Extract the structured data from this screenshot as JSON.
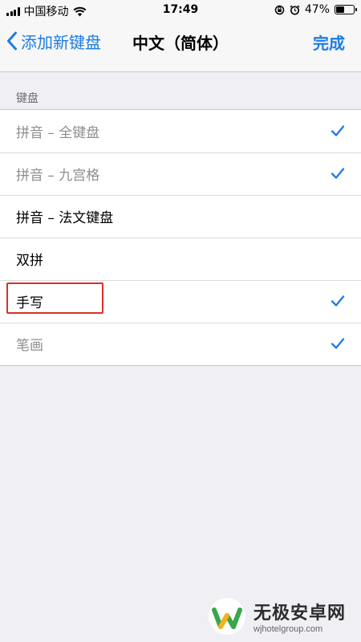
{
  "status_bar": {
    "carrier": "中国移动",
    "time": "17:49",
    "battery_percent": "47%",
    "battery_level": 0.47,
    "icons": [
      "signal-icon",
      "wifi-icon",
      "rotation-lock-icon",
      "alarm-icon",
      "battery-icon"
    ]
  },
  "nav": {
    "back_label": "添加新键盘",
    "title": "中文（简体）",
    "done_label": "完成"
  },
  "section": {
    "header": "键盘"
  },
  "rows": [
    {
      "label": "拼音 – 全键盘",
      "checked": true,
      "dimmed": true
    },
    {
      "label": "拼音 – 九宫格",
      "checked": true,
      "dimmed": true
    },
    {
      "label": "拼音 – 法文键盘",
      "checked": false,
      "dimmed": false
    },
    {
      "label": "双拼",
      "checked": false,
      "dimmed": false
    },
    {
      "label": "手写",
      "checked": true,
      "dimmed": false
    },
    {
      "label": "笔画",
      "checked": true,
      "dimmed": true
    }
  ],
  "colors": {
    "accent": "#1c7ce5",
    "highlight": "#d9302c",
    "background": "#efeff4"
  },
  "watermark": {
    "name": "无极安卓网",
    "url": "wjhotelgroup.com"
  }
}
